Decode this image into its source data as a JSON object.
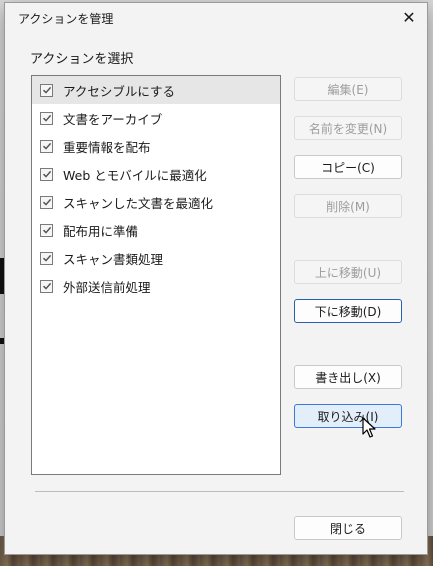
{
  "dialog": {
    "title": "アクションを管理",
    "section_label": "アクションを選択"
  },
  "actions": [
    {
      "label": "アクセシブルにする",
      "checked": true,
      "selected": true
    },
    {
      "label": "文書をアーカイブ",
      "checked": true,
      "selected": false
    },
    {
      "label": "重要情報を配布",
      "checked": true,
      "selected": false
    },
    {
      "label": "Web とモバイルに最適化",
      "checked": true,
      "selected": false
    },
    {
      "label": "スキャンした文書を最適化",
      "checked": true,
      "selected": false
    },
    {
      "label": "配布用に準備",
      "checked": true,
      "selected": false
    },
    {
      "label": "スキャン書類処理",
      "checked": true,
      "selected": false
    },
    {
      "label": "外部送信前処理",
      "checked": true,
      "selected": false
    }
  ],
  "buttons": {
    "edit": "編集(E)",
    "rename": "名前を変更(N)",
    "copy": "コピー(C)",
    "delete": "削除(M)",
    "move_up": "上に移動(U)",
    "move_down": "下に移動(D)",
    "export": "書き出し(X)",
    "import": "取り込み(I)",
    "close": "閉じる"
  },
  "icons": {
    "close": "close-icon",
    "check": "check-icon",
    "cursor": "mouse-pointer-icon"
  },
  "colors": {
    "focus_border": "#2a5fb0",
    "hover_background": "#e3eefb",
    "disabled_text": "#9d9d9d",
    "selected_row": "#e6e6e6"
  }
}
